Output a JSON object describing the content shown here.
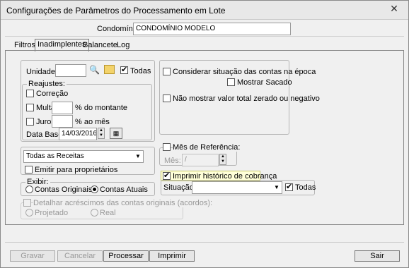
{
  "window": {
    "title": "Configurações de Parâmetros do Processamento em Lote"
  },
  "condominio": {
    "label": "Condomínio:",
    "value": "CONDOMÍNIO MODELO"
  },
  "tabs": [
    {
      "label": "Filtros"
    },
    {
      "label": "Inadimplentes"
    },
    {
      "label": "Balancete"
    },
    {
      "label": "Log"
    }
  ],
  "unidade": {
    "label": "Unidade:",
    "value": "",
    "todas_label": "Todas",
    "todas_checked": true
  },
  "reajustes": {
    "legend": "Reajustes:",
    "correcao": "Correção",
    "multa": "Multa",
    "multa_suffix": "% do montante",
    "juros": "Juros",
    "juros_suffix": "% ao mês",
    "data_base_label": "Data Base:",
    "data_base_value": "14/03/2016"
  },
  "receitas": {
    "selected": "Todas as Receitas",
    "emitir_label": "Emitir para proprietários"
  },
  "exibir": {
    "legend": "Exibir:",
    "option1": "Contas Originais",
    "option2": "Contas Atuais",
    "selected": "Contas Atuais"
  },
  "detalhar": {
    "label": "Detalhar acréscimos das contas originais (acordos):",
    "option1": "Projetado",
    "option2": "Real"
  },
  "right": {
    "considerar": "Considerar situação das contas na época",
    "mostrar_sacado": "Mostrar Sacado",
    "nao_mostrar": "Não mostrar valor total zerado ou negativo",
    "mes_ref": "Mês de Referência:",
    "mes_label": "Mês:",
    "mes_value": "/",
    "imprimir_historico": "Imprimir histórico de cobrança",
    "situacao_label": "Situação:",
    "situacao_value": "",
    "todas_label": "Todas"
  },
  "buttons": {
    "gravar": "Gravar",
    "cancelar": "Cancelar",
    "processar": "Processar",
    "imprimir": "Imprimir",
    "sair": "Sair"
  }
}
